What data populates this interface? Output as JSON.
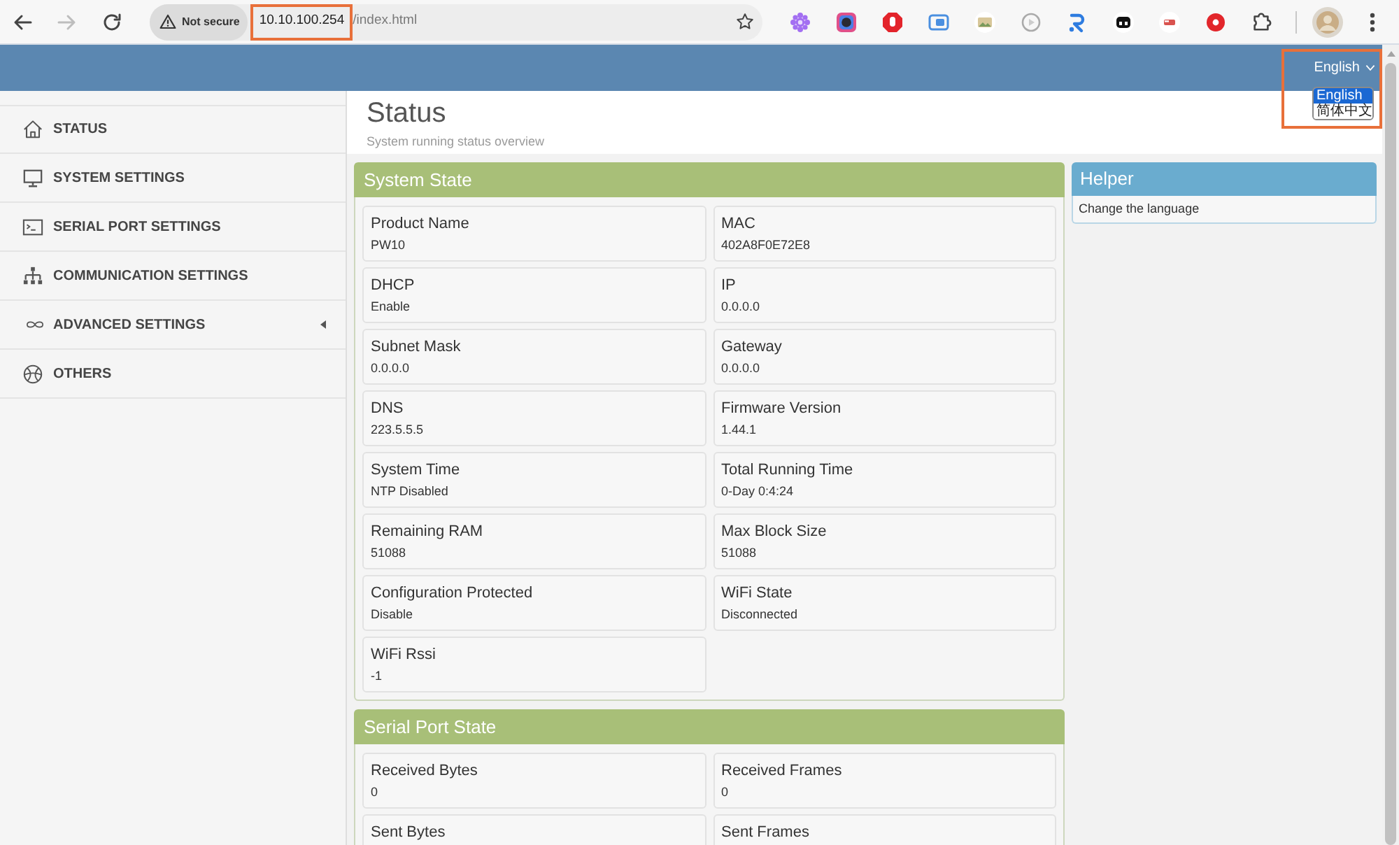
{
  "browser": {
    "forward_disabled": true,
    "security_label": "Not secure",
    "url_host": "10.10.100.254",
    "url_path": "/index.html",
    "host_highlighted": true
  },
  "header": {
    "language": {
      "label": "English",
      "expanded": true,
      "highlighted": true,
      "options": [
        {
          "label": "English",
          "selected": true
        },
        {
          "label": "简体中文",
          "selected": false
        }
      ]
    }
  },
  "sidebar": {
    "items": [
      {
        "kind": "home",
        "label": "STATUS",
        "has_submenu": false
      },
      {
        "kind": "monitor",
        "label": "SYSTEM SETTINGS",
        "has_submenu": false
      },
      {
        "kind": "terminal",
        "label": "SERIAL PORT SETTINGS",
        "has_submenu": false
      },
      {
        "kind": "network",
        "label": "COMMUNICATION SETTINGS",
        "has_submenu": false
      },
      {
        "kind": "infinity",
        "label": "ADVANCED SETTINGS",
        "has_submenu": true
      },
      {
        "kind": "ball",
        "label": "OTHERS",
        "has_submenu": false
      }
    ]
  },
  "page": {
    "title": "Status",
    "subtitle": "System running status overview"
  },
  "panels": [
    {
      "title": "System State",
      "fields": [
        {
          "label": "Product Name",
          "value": "PW10"
        },
        {
          "label": "MAC",
          "value": "402A8F0E72E8"
        },
        {
          "label": "DHCP",
          "value": "Enable"
        },
        {
          "label": "IP",
          "value": "0.0.0.0"
        },
        {
          "label": "Subnet Mask",
          "value": "0.0.0.0"
        },
        {
          "label": "Gateway",
          "value": "0.0.0.0"
        },
        {
          "label": "DNS",
          "value": "223.5.5.5"
        },
        {
          "label": "Firmware Version",
          "value": "1.44.1"
        },
        {
          "label": "System Time",
          "value": "NTP Disabled"
        },
        {
          "label": "Total Running Time",
          "value": "0-Day 0:4:24"
        },
        {
          "label": "Remaining RAM",
          "value": "51088"
        },
        {
          "label": "Max Block Size",
          "value": "51088"
        },
        {
          "label": "Configuration Protected",
          "value": "Disable"
        },
        {
          "label": "WiFi State",
          "value": "Disconnected"
        },
        {
          "label": "WiFi Rssi",
          "value": "-1"
        }
      ]
    },
    {
      "title": "Serial Port State",
      "fields": [
        {
          "label": "Received Bytes",
          "value": "0"
        },
        {
          "label": "Received Frames",
          "value": "0"
        },
        {
          "label": "Sent Bytes"
        },
        {
          "label": "Sent Frames"
        }
      ]
    }
  ],
  "helper": {
    "title": "Helper",
    "text": "Change the language"
  }
}
